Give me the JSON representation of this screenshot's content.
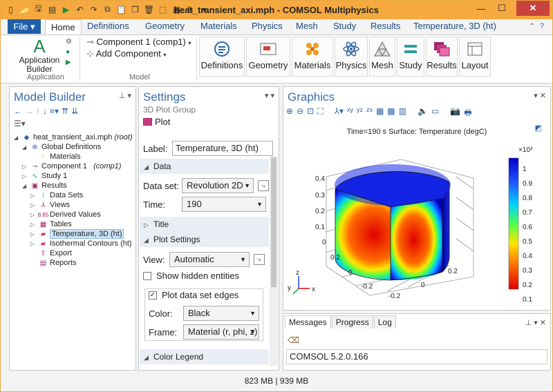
{
  "window": {
    "title": "heat_transient_axi.mph - COMSOL Multiphysics",
    "min_glyph": "—",
    "max_glyph": "☐",
    "close_glyph": "✕",
    "accent_color": "#f5a93f",
    "qat_icons": [
      "file-icon",
      "open-icon",
      "save-icon",
      "save-as-icon",
      "run-icon",
      "undo-icon",
      "redo-icon",
      "copy-icon",
      "paste-icon",
      "duplicate-icon",
      "delete-icon",
      "select-icon",
      "table-icon",
      "tools-icon",
      "customize-icon"
    ]
  },
  "ribbon": {
    "file_label": "File ▾",
    "tabs": [
      "Home",
      "Definitions",
      "Geometry",
      "Materials",
      "Physics",
      "Mesh",
      "Study",
      "Results",
      "Temperature, 3D (ht)"
    ],
    "active_tab": "Home",
    "application_builder_label": "Application Builder",
    "application_group": "Application",
    "component_label": "Component 1 (comp1)",
    "add_component_label": "Add Component",
    "model_group": "Model",
    "buttons": [
      "Definitions",
      "Geometry",
      "Materials",
      "Physics",
      "Mesh",
      "Study",
      "Results",
      "Layout"
    ]
  },
  "model_builder": {
    "title": "Model Builder",
    "tree": [
      {
        "label": "heat_transient_axi.mph",
        "suffix": "(root)",
        "icon": "root-icon"
      },
      {
        "label": "Global Definitions",
        "icon": "global-definitions-icon"
      },
      {
        "label": "Materials",
        "icon": "materials-icon"
      },
      {
        "label": "Component 1",
        "suffix": "(comp1)",
        "icon": "component-icon"
      },
      {
        "label": "Study 1",
        "icon": "study-icon"
      },
      {
        "label": "Results",
        "icon": "results-icon"
      },
      {
        "label": "Data Sets",
        "icon": "data-sets-icon"
      },
      {
        "label": "Views",
        "icon": "views-icon"
      },
      {
        "label": "Derived Values",
        "icon": "derived-values-icon"
      },
      {
        "label": "Tables",
        "icon": "tables-icon"
      },
      {
        "label": "Temperature, 3D (ht)",
        "icon": "plot-group-3d-icon"
      },
      {
        "label": "Isothermal Contours (ht)",
        "icon": "plot-group-3d-icon"
      },
      {
        "label": "Export",
        "icon": "export-icon"
      },
      {
        "label": "Reports",
        "icon": "reports-icon"
      }
    ]
  },
  "settings": {
    "title": "Settings",
    "subtitle": "3D Plot Group",
    "node_label": "Plot",
    "label_field_label": "Label:",
    "label_value": "Temperature, 3D (ht)",
    "data_section": "Data",
    "dataset_label": "Data set:",
    "dataset_value": "Revolution 2D",
    "time_label": "Time:",
    "time_value": "190",
    "title_section": "Title",
    "plot_settings_section": "Plot Settings",
    "view_label": "View:",
    "view_value": "Automatic",
    "show_hidden_label": "Show hidden entities",
    "show_hidden_checked": false,
    "plot_edges_label": "Plot data set edges",
    "plot_edges_checked": true,
    "color_label": "Color:",
    "color_value": "Black",
    "frame_label": "Frame:",
    "frame_value": "Material  (r, phi, z)",
    "color_legend_section": "Color Legend"
  },
  "graphics": {
    "title": "Graphics",
    "caption": "Time=190 s   Surface: Temperature (degC)",
    "legend_exponent": "×10³",
    "legend_ticks": [
      "1",
      "0.9",
      "0.8",
      "0.7",
      "0.6",
      "0.5",
      "0.4",
      "0.3",
      "0.2",
      "0.1"
    ],
    "z_ticks": [
      "0.4",
      "0.3",
      "0.2",
      "0.1",
      "0"
    ],
    "axis_ticks": [
      "0.2",
      "0",
      "-0.2",
      "0.2",
      "0",
      "-0.2"
    ],
    "triad": {
      "x": "x",
      "y": "y",
      "z": "z"
    }
  },
  "messages": {
    "tabs": [
      "Messages",
      "Progress",
      "Log"
    ],
    "active": "Messages",
    "text": "COMSOL 5.2.0.166"
  },
  "status": {
    "memory": "823 MB | 939 MB"
  }
}
